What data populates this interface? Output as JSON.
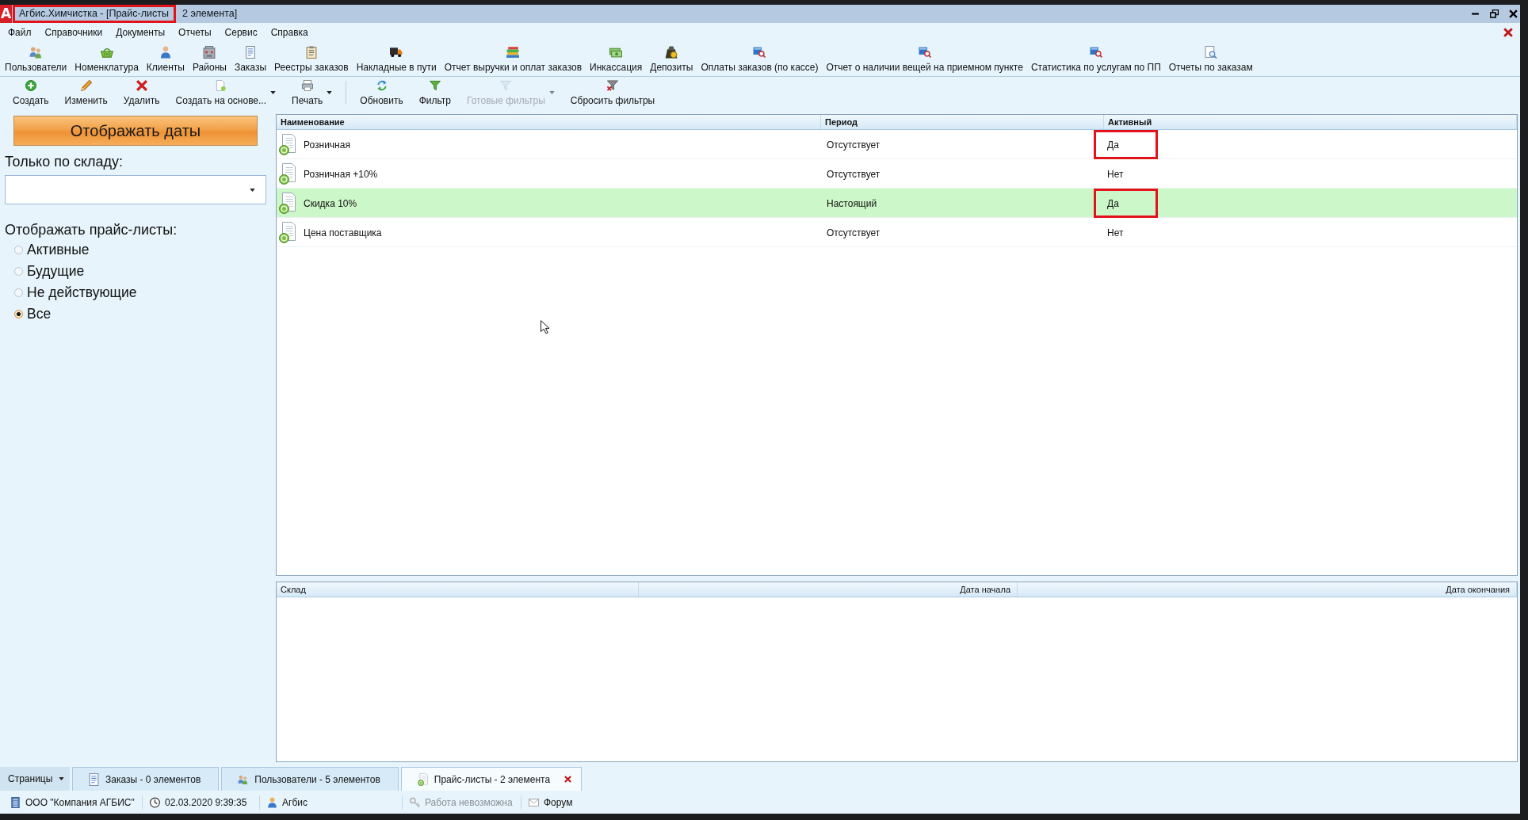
{
  "window": {
    "logo": "A",
    "title_parts": [
      {
        "text": "Агбис.Химчистка - [Прайс-листы",
        "highlighted": true
      },
      {
        "text": "2 элемента]",
        "highlighted": false
      }
    ]
  },
  "menu": [
    "Файл",
    "Справочники",
    "Документы",
    "Отчеты",
    "Сервис",
    "Справка"
  ],
  "main_toolbar": [
    "Пользователи",
    "Номенклатура",
    "Клиенты",
    "Районы",
    "Заказы",
    "Реестры заказов",
    "Накладные в пути",
    "Отчет выручки и оплат заказов",
    "Инкассация",
    "Депозиты",
    "Оплаты заказов (по кассе)",
    "Отчет о наличии вещей на приемном пункте",
    "Статистика по услугам по ПП",
    "Отчеты по заказам"
  ],
  "action_toolbar": {
    "groups": [
      [
        {
          "label": "Создать",
          "disabled": false,
          "dropdown": false
        },
        {
          "label": "Изменить",
          "disabled": false,
          "dropdown": false
        },
        {
          "label": "Удалить",
          "disabled": false,
          "dropdown": false
        },
        {
          "label": "Создать на основе...",
          "disabled": false,
          "dropdown": true
        },
        {
          "label": "Печать",
          "disabled": false,
          "dropdown": true
        }
      ],
      [
        {
          "label": "Обновить",
          "disabled": false,
          "dropdown": false
        },
        {
          "label": "Фильтр",
          "disabled": false,
          "dropdown": false
        },
        {
          "label": "Готовые фильтры",
          "disabled": true,
          "dropdown": true
        },
        {
          "label": "Сбросить фильтры",
          "disabled": false,
          "dropdown": false
        }
      ]
    ]
  },
  "left_panel": {
    "show_dates_button": "Отображать даты",
    "warehouse_label": "Только по складу:",
    "price_list_filter": {
      "label": "Отображать прайс-листы:",
      "options": [
        {
          "label": "Активные",
          "selected": false
        },
        {
          "label": "Будущие",
          "selected": false
        },
        {
          "label": "Не действующие",
          "selected": false
        },
        {
          "label": "Все",
          "selected": true
        }
      ]
    }
  },
  "price_lists": {
    "columns": [
      "Наименование",
      "Период",
      "Активный"
    ],
    "rows": [
      {
        "name": "Розничная",
        "period": "Отсутствует",
        "active": "Да",
        "selected": false,
        "active_highlighted": true
      },
      {
        "name": "Розничная +10%",
        "period": "Отсутствует",
        "active": "Нет",
        "selected": false,
        "active_highlighted": false
      },
      {
        "name": "Скидка 10%",
        "period": "Настоящий",
        "active": "Да",
        "selected": true,
        "active_highlighted": true
      },
      {
        "name": "Цена поставщика",
        "period": "Отсутствует",
        "active": "Нет",
        "selected": false,
        "active_highlighted": false
      }
    ]
  },
  "details": {
    "columns": [
      "Склад",
      "Дата начала",
      "Дата окончания"
    ]
  },
  "pages_button": "Страницы",
  "page_tabs": [
    {
      "label": "Заказы - 0 элементов",
      "selected": false
    },
    {
      "label": "Пользователи - 5 элементов",
      "selected": false
    },
    {
      "label": "Прайс-листы - 2 элемента",
      "selected": true
    }
  ],
  "status_bar": [
    {
      "text": "ООО \"Компания АГБИС\"",
      "disabled": false
    },
    {
      "text": "02.03.2020 9:39:35",
      "disabled": false
    },
    {
      "text": "Агбис",
      "disabled": false
    },
    {
      "text": "Работа невозможна",
      "disabled": true
    },
    {
      "text": "Форум",
      "disabled": false
    }
  ]
}
